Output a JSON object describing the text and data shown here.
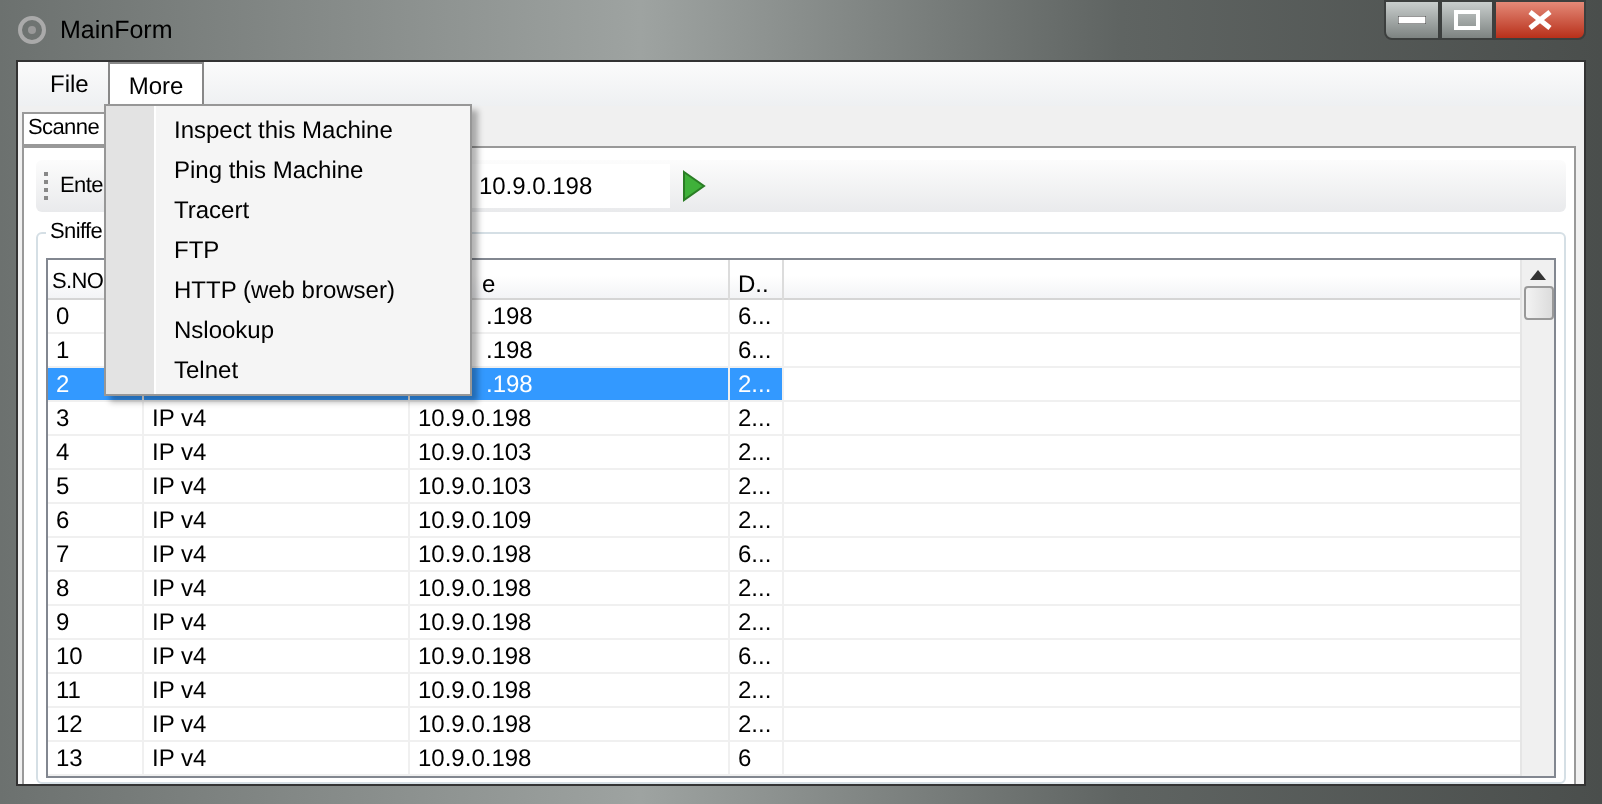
{
  "window": {
    "title": "MainForm"
  },
  "menu_bar": [
    {
      "label": "File",
      "selected": false
    },
    {
      "label": "More",
      "selected": true
    }
  ],
  "menu": [
    "Inspect this Machine",
    "Ping this Machine",
    "Tracert",
    "FTP",
    "HTTP (web browser)",
    "Nslookup",
    "Telnet"
  ],
  "tabs": [
    {
      "label": "Scanne",
      "selected": true
    }
  ],
  "toolbar": {
    "label": "Ente",
    "address": "10.9.0.198"
  },
  "group": {
    "title": "Sniffe"
  },
  "table": {
    "columns": [
      "S.NO",
      "",
      "e",
      "D.."
    ],
    "rows": [
      {
        "cells": [
          "0",
          "",
          ".198",
          "6..."
        ],
        "under_menu": true,
        "selected": false
      },
      {
        "cells": [
          "1",
          "",
          ".198",
          "6..."
        ],
        "under_menu": true,
        "selected": false
      },
      {
        "cells": [
          "2",
          "",
          ".198",
          "2..."
        ],
        "under_menu": true,
        "selected": true
      },
      {
        "cells": [
          "3",
          "IP v4",
          "10.9.0.198",
          "2..."
        ],
        "under_menu": false,
        "selected": false
      },
      {
        "cells": [
          "4",
          "IP v4",
          "10.9.0.103",
          "2..."
        ],
        "under_menu": false,
        "selected": false
      },
      {
        "cells": [
          "5",
          "IP v4",
          "10.9.0.103",
          "2..."
        ],
        "under_menu": false,
        "selected": false
      },
      {
        "cells": [
          "6",
          "IP v4",
          "10.9.0.109",
          "2..."
        ],
        "under_menu": false,
        "selected": false
      },
      {
        "cells": [
          "7",
          "IP v4",
          "10.9.0.198",
          "6..."
        ],
        "under_menu": false,
        "selected": false
      },
      {
        "cells": [
          "8",
          "IP v4",
          "10.9.0.198",
          "2..."
        ],
        "under_menu": false,
        "selected": false
      },
      {
        "cells": [
          "9",
          "IP v4",
          "10.9.0.198",
          "2..."
        ],
        "under_menu": false,
        "selected": false
      },
      {
        "cells": [
          "10",
          "IP v4",
          "10.9.0.198",
          "6..."
        ],
        "under_menu": false,
        "selected": false
      },
      {
        "cells": [
          "11",
          "IP v4",
          "10.9.0.198",
          "2..."
        ],
        "under_menu": false,
        "selected": false
      },
      {
        "cells": [
          "12",
          "IP v4",
          "10.9.0.198",
          "2..."
        ],
        "under_menu": false,
        "selected": false
      },
      {
        "cells": [
          "13",
          "IP v4",
          "10.9.0.198",
          "6"
        ],
        "under_menu": false,
        "selected": false
      }
    ]
  }
}
